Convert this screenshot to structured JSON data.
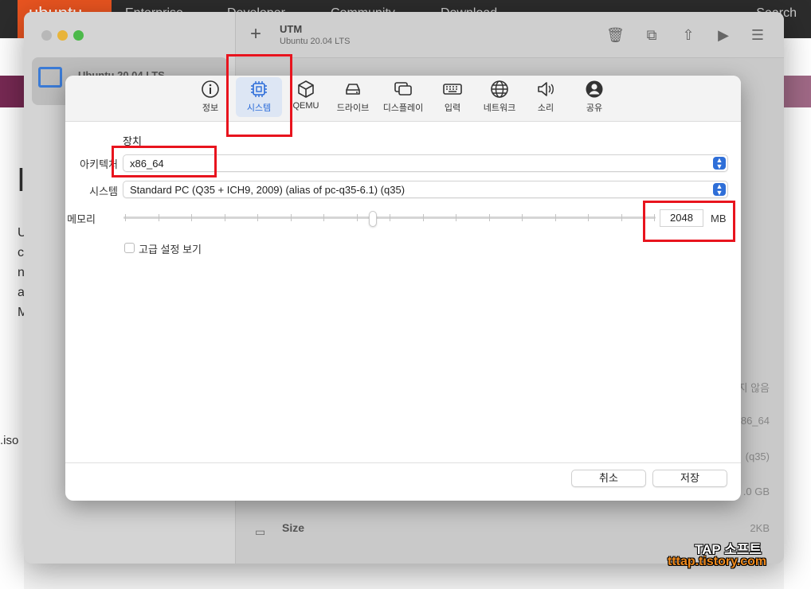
{
  "background_site": {
    "logo": "ubuntu",
    "nav": [
      "Enterprise",
      "Developer",
      "Community",
      "Download"
    ],
    "search": "Search",
    "left_text": [
      "U",
      "c",
      "n",
      "a",
      "M"
    ],
    "iso": ".iso"
  },
  "utm": {
    "app_title": "UTM",
    "vm_subtitle": "Ubuntu 20.04 LTS",
    "vm_name": "Ubuntu 20.04 LTS",
    "info_rows": [
      "지 않음",
      "86_64",
      "(q35)",
      ".0 GB",
      "2KB"
    ],
    "size_label": "Size"
  },
  "dialog": {
    "tabs": [
      {
        "label": "정보",
        "icon": "info-icon"
      },
      {
        "label": "시스템",
        "icon": "cpu-icon",
        "active": true
      },
      {
        "label": "QEMU",
        "icon": "cube-icon"
      },
      {
        "label": "드라이브",
        "icon": "drive-icon"
      },
      {
        "label": "디스플레이",
        "icon": "display-icon"
      },
      {
        "label": "입력",
        "icon": "keyboard-icon"
      },
      {
        "label": "네트워크",
        "icon": "globe-icon"
      },
      {
        "label": "소리",
        "icon": "speaker-icon"
      },
      {
        "label": "공유",
        "icon": "person-icon"
      }
    ],
    "section_title": "장치",
    "architecture_label": "아키텍처",
    "architecture_value": "x86_64",
    "system_label": "시스템",
    "system_value": "Standard PC (Q35 + ICH9, 2009) (alias of pc-q35-6.1) (q35)",
    "memory_label": "메모리",
    "memory_value": "2048",
    "memory_unit": "MB",
    "advanced_checkbox_label": "고급 설정 보기",
    "cancel_label": "취소",
    "save_label": "저장"
  },
  "watermark": {
    "line1": "TAP 소프트",
    "line2": "tttap.tistory.com"
  },
  "colors": {
    "accent": "#2f6fd8",
    "highlight": "#e8141e",
    "ubuntu_orange": "#e95420"
  }
}
